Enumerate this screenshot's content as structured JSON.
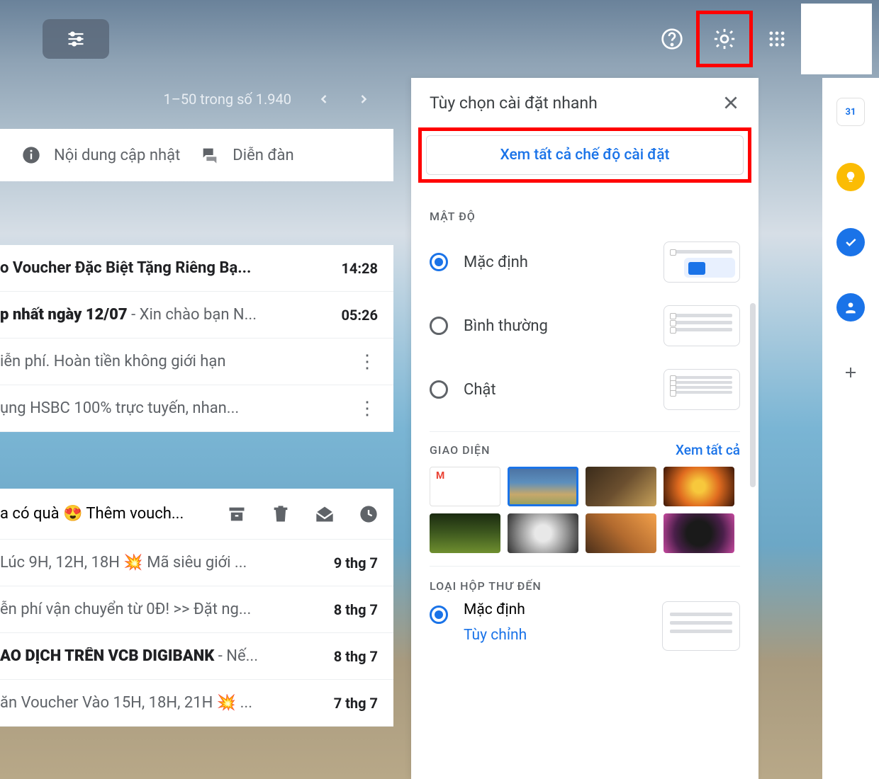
{
  "header": {
    "pager_text": "1–50 trong số 1.940"
  },
  "tabs": {
    "updates": "Nội dung cập nhật",
    "forums": "Diễn đàn"
  },
  "emails": {
    "r1_subj": "o Voucher Đặc Biệt Tặng Riêng Bạ...",
    "r1_time": "14:28",
    "r2_subj_bold": "p nhất ngày 12/07",
    "r2_snip": " - Xin chào bạn N...",
    "r2_time": "05:26",
    "r3_subj": "iễn phí. Hoàn tiền không giới hạn",
    "r4_subj": "ụng HSBC 100% trực tuyến, nhan...",
    "sel_subj": "a có quà 😍 Thêm vouch...",
    "r5_subj": "Lúc 9H, 12H, 18H 💥 Mã siêu giới ...",
    "r5_time": "9 thg 7",
    "r6_subj": "ễn phí vận chuyển từ 0Đ! >> Đặt ng...",
    "r6_time": "8 thg 7",
    "r7_bold": "AO DỊCH TRÊN VCB DIGIBANK",
    "r7_snip": " - Nế...",
    "r7_time": "8 thg 7",
    "r8_subj": "ăn Voucher Vào 15H, 18H, 21H 💥 ...",
    "r8_time": "7 thg 7"
  },
  "qs": {
    "title": "Tùy chọn cài đặt nhanh",
    "all_settings": "Xem tất cả chế độ cài đặt",
    "density_title": "MẬT ĐỘ",
    "density_default": "Mặc định",
    "density_comfortable": "Bình thường",
    "density_compact": "Chật",
    "theme_title": "GIAO DIỆN",
    "view_all": "Xem tất cả",
    "inbox_type_title": "LOẠI HỘP THƯ ĐẾN",
    "inbox_default": "Mặc định",
    "inbox_custom": "Tùy chỉnh"
  },
  "rail": {
    "cal_day": "31"
  }
}
